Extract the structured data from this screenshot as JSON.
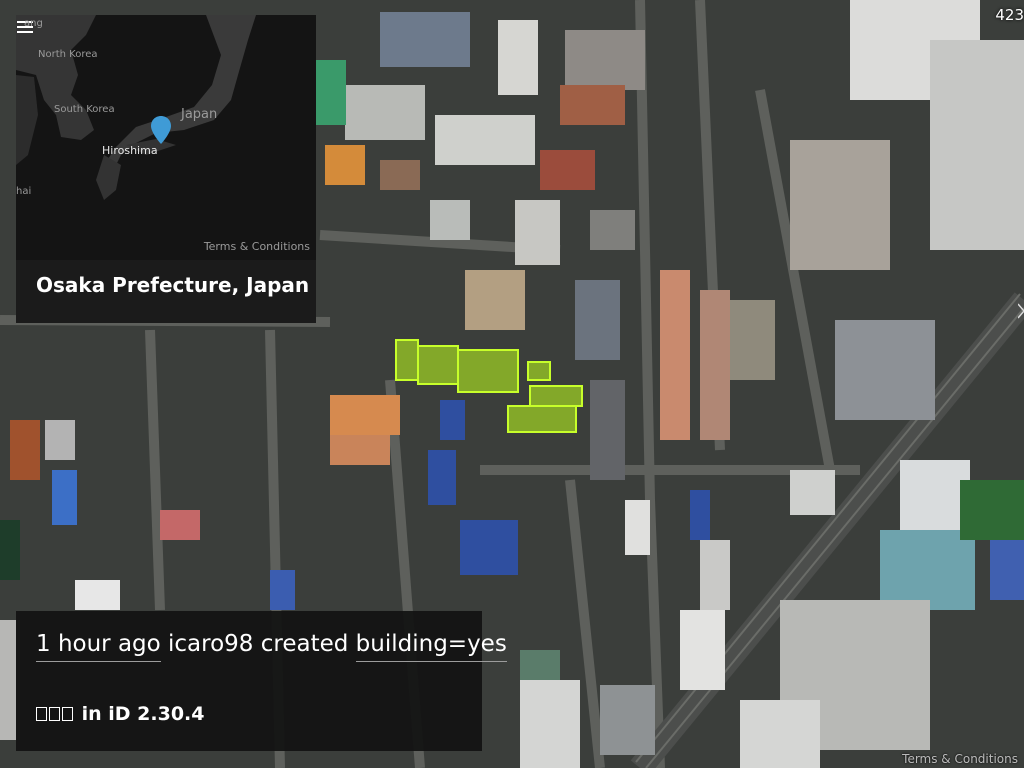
{
  "overview": {
    "map_labels": {
      "top_left_fragment": "ang",
      "country_north": "North Korea",
      "country_south": "South Korea",
      "country_main": "Japan",
      "city": "Hiroshima",
      "left_edge_fragment": "hai"
    },
    "terms": "Terms & Conditions",
    "place_name": "Osaka Prefecture, Japan",
    "pin_color": "#3f9bd6"
  },
  "top_right_count": "423",
  "changeset": {
    "time": "1 hour ago",
    "user": "icaro98",
    "action": "created",
    "tag": "building=yes",
    "editor": "in iD 2.30.4"
  },
  "attribution": "Terms & Conditions",
  "colors": {
    "highlight_buildings": "#b4f01e",
    "panel_background": "#1b1b1b"
  }
}
